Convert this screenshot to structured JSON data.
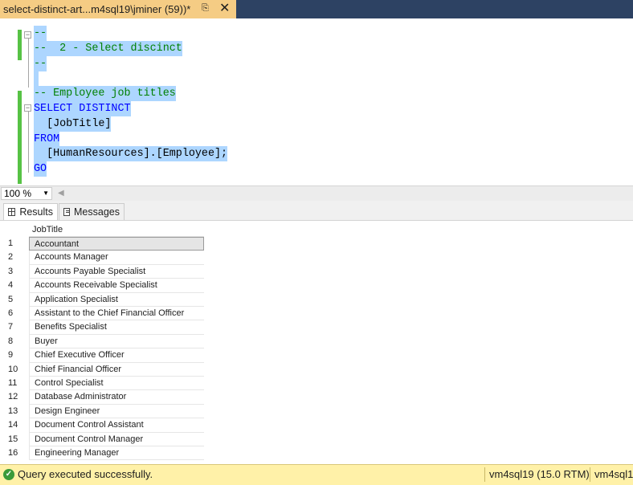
{
  "tab": {
    "title": "select-distinct-art...m4sql19\\jminer (59))*",
    "pin_icon": "pin-icon",
    "close_icon": "close-icon"
  },
  "editor": {
    "lines": [
      "--",
      "--  2 - Select discinct",
      "--",
      "",
      "-- Employee job titles",
      "SELECT DISTINCT",
      "  [JobTitle]",
      "FROM",
      "  [HumanResources].[Employee];",
      "GO"
    ]
  },
  "zoom": {
    "value": "100 %"
  },
  "results_tabs": {
    "results": "Results",
    "messages": "Messages"
  },
  "grid": {
    "column": "JobTitle",
    "rows": [
      {
        "num": "1",
        "value": "Accountant"
      },
      {
        "num": "2",
        "value": "Accounts Manager"
      },
      {
        "num": "3",
        "value": "Accounts Payable Specialist"
      },
      {
        "num": "4",
        "value": "Accounts Receivable Specialist"
      },
      {
        "num": "5",
        "value": "Application Specialist"
      },
      {
        "num": "6",
        "value": "Assistant to the Chief Financial Officer"
      },
      {
        "num": "7",
        "value": "Benefits Specialist"
      },
      {
        "num": "8",
        "value": "Buyer"
      },
      {
        "num": "9",
        "value": "Chief Executive Officer"
      },
      {
        "num": "10",
        "value": "Chief Financial Officer"
      },
      {
        "num": "11",
        "value": "Control Specialist"
      },
      {
        "num": "12",
        "value": "Database Administrator"
      },
      {
        "num": "13",
        "value": "Design Engineer"
      },
      {
        "num": "14",
        "value": "Document Control Assistant"
      },
      {
        "num": "15",
        "value": "Document Control Manager"
      },
      {
        "num": "16",
        "value": "Engineering Manager"
      }
    ]
  },
  "status": {
    "message": "Query executed successfully.",
    "server": "vm4sql19 (15.0 RTM)",
    "server2": "vm4sql1"
  },
  "colors": {
    "tab_active": "#f5cc84",
    "tabbar_bg": "#2d4263",
    "selection": "#add6ff",
    "comment": "#008000",
    "keyword": "#0000ff",
    "change_marker": "#57c245",
    "status_bg": "#fff1a8"
  }
}
